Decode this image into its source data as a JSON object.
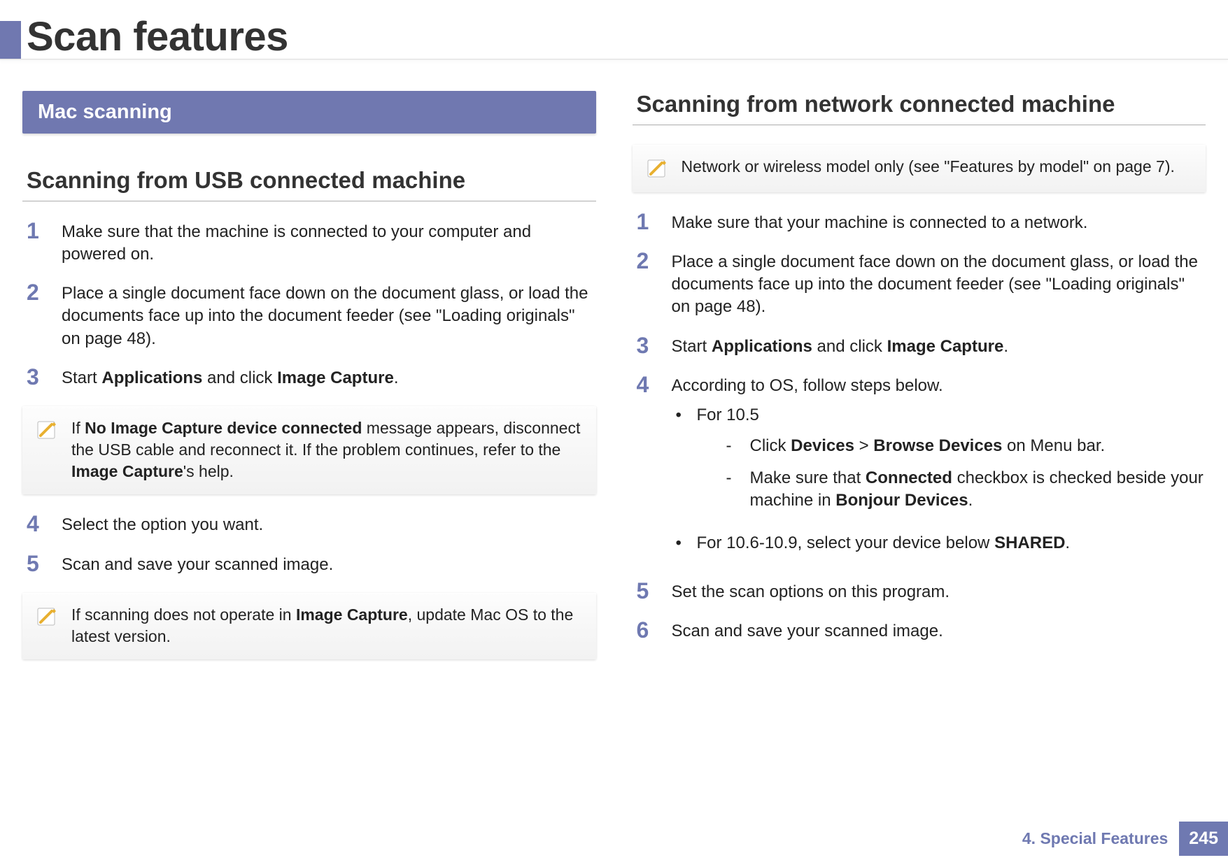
{
  "page_title": "Scan features",
  "left": {
    "section_band": "Mac scanning",
    "subheading": "Scanning from USB connected machine",
    "steps": {
      "s1": {
        "num": "1",
        "text": "Make sure that the machine is connected to your computer and powered on."
      },
      "s2": {
        "num": "2",
        "text": "Place a single document face down on the document glass, or load the documents face up into the document feeder (see \"Loading originals\" on page 48)."
      },
      "s3": {
        "num": "3",
        "pre": "Start ",
        "b1": "Applications",
        "mid": " and click ",
        "b2": "Image Capture",
        "post": "."
      },
      "s4": {
        "num": "4",
        "text": "Select the option you want."
      },
      "s5": {
        "num": "5",
        "text": "Scan and save your scanned image."
      }
    },
    "note1": {
      "pre": "If ",
      "b1": "No Image Capture device connected",
      "mid": " message appears, disconnect the USB cable and reconnect it. If the problem continues, refer to the ",
      "b2": "Image Capture",
      "post": "'s help."
    },
    "note2": {
      "pre": "If scanning does not operate in ",
      "b1": "Image Capture",
      "post": ", update Mac OS to the latest version."
    }
  },
  "right": {
    "subheading": "Scanning from network connected machine",
    "note1": {
      "text": "Network or wireless model only (see \"Features by model\" on page 7)."
    },
    "steps": {
      "s1": {
        "num": "1",
        "text": "Make sure that your machine is connected to a network."
      },
      "s2": {
        "num": "2",
        "text": "Place a single document face down on the document glass, or load the documents face up into the document feeder (see \"Loading originals\" on page 48)."
      },
      "s3": {
        "num": "3",
        "pre": "Start ",
        "b1": "Applications",
        "mid": " and click ",
        "b2": "Image Capture",
        "post": "."
      },
      "s4": {
        "num": "4",
        "intro": " According to OS, follow steps below.",
        "a_label": "For 10.5",
        "a1_pre": "Click ",
        "a1_b1": "Devices",
        "a1_mid": " > ",
        "a1_b2": "Browse Devices",
        "a1_post": " on Menu bar.",
        "a2_pre": "Make sure that ",
        "a2_b1": "Connected",
        "a2_mid": " checkbox is checked beside your machine in ",
        "a2_b2": "Bonjour Devices",
        "a2_post": ".",
        "b_pre": "For 10.6-10.9, select your device below ",
        "b_b1": "SHARED",
        "b_post": "."
      },
      "s5": {
        "num": "5",
        "text": "Set the scan options on this program."
      },
      "s6": {
        "num": "6",
        "text": "Scan and save your scanned image."
      }
    }
  },
  "footer": {
    "chapter": "4.  Special Features",
    "page": "245"
  },
  "bullets": {
    "dot": "•",
    "dash": "-"
  }
}
